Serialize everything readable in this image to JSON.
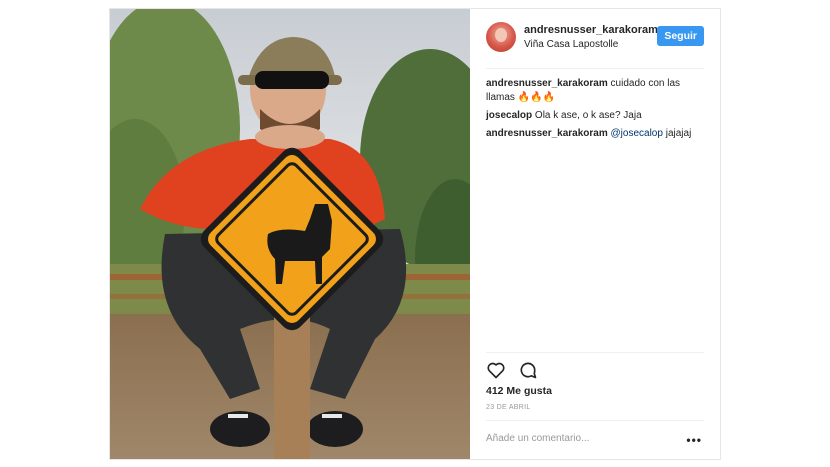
{
  "header": {
    "username": "andresnusser_karakoram",
    "location": "Viña Casa Lapostolle",
    "follow_label": "Seguir"
  },
  "comments": [
    {
      "user": "andresnusser_karakoram",
      "text": "cuidado con las llamas 🔥🔥🔥"
    },
    {
      "user": "josecalop",
      "text": "Ola k ase, o k ase? Jaja"
    },
    {
      "user": "andresnusser_karakoram",
      "mention": "@josecalop",
      "text": "jajajaj"
    }
  ],
  "likes": "412 Me gusta",
  "date": "23 DE ABRIL",
  "add_comment_placeholder": "Añade un comentario...",
  "more_label": "•••",
  "icons": {
    "like": "heart-icon",
    "comment": "speech-bubble-icon"
  },
  "colors": {
    "follow_button": "#3897f0",
    "sign": "#f2a11a",
    "jacket": "#e0411f"
  }
}
